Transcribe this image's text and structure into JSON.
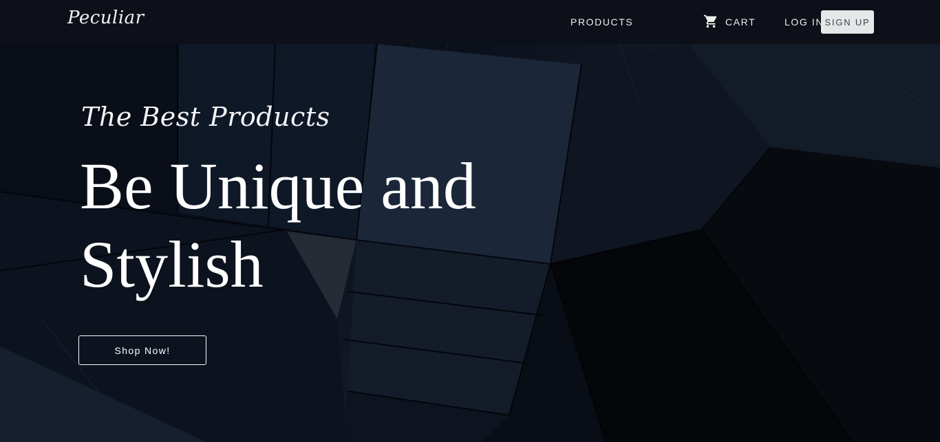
{
  "nav": {
    "brand": "Peculiar",
    "products_label": "PRODUCTS",
    "cart_label": "CART",
    "cart_icon": "cart-icon",
    "login_label": "LOG IN",
    "signup_label": "SIGN UP"
  },
  "hero": {
    "tagline": "The Best Products",
    "headline_line1": "Be Unique and",
    "headline_line2": "Stylish",
    "cta_label": "Shop Now!"
  },
  "colors": {
    "navbar_bg": "#0d1018",
    "signup_bg": "#e6e7e9",
    "hero_base": "#0f1726"
  }
}
